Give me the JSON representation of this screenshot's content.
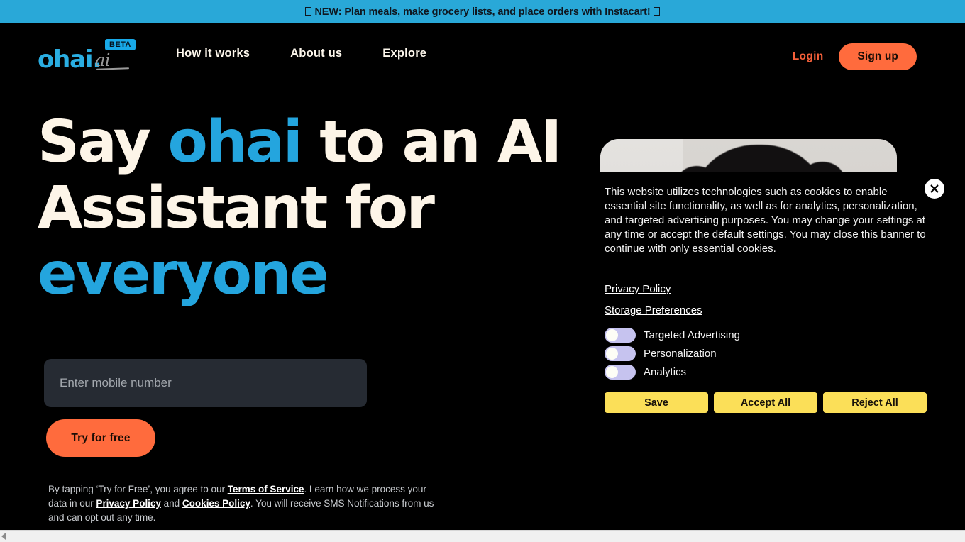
{
  "announcement": {
    "text": "NEW: Plan meals, make grocery lists, and place orders with Instacart!",
    "leading_icon": "missing-glyph-box",
    "trailing_icon": "missing-glyph-box",
    "background": "#29a8d8"
  },
  "header": {
    "logo": {
      "main": "ohai.",
      "suffix": "ai",
      "badge": "BETA",
      "main_color": "#2aaee2",
      "badge_color": "#18a9e8"
    },
    "nav": [
      {
        "label": "How it works"
      },
      {
        "label": "About us"
      },
      {
        "label": "Explore"
      }
    ],
    "login_label": "Login",
    "signup_label": "Sign up",
    "accent_color": "#ff6b3d"
  },
  "hero": {
    "title_part1": "Say ",
    "title_highlight1": "ohai",
    "title_part2": " to an AI Assistant for ",
    "title_highlight2": "everyone",
    "highlight_color": "#24a5de",
    "title_color": "#fdf5e8",
    "phone_placeholder": "Enter mobile number",
    "phone_value": "",
    "cta_label": "Try for free",
    "legal": {
      "seg1": "By tapping ‘Try for Free’, you agree to our ",
      "link1": "Terms of Service",
      "seg2": ". Learn how we process your data in our ",
      "link2": "Privacy Policy",
      "seg3": " and ",
      "link3": "Cookies Policy",
      "seg4": ". You will receive SMS Notifications from us and can opt out any time."
    }
  },
  "cookie_banner": {
    "body": "This website utilizes technologies such as cookies to enable essential site functionality, as well as for analytics, personalization, and targeted advertising purposes. You may change your settings at any time or accept the default settings. You may close this banner to continue with only essential cookies.",
    "links": [
      {
        "label": "Privacy Policy"
      },
      {
        "label": "Storage Preferences"
      }
    ],
    "preferences": [
      {
        "label": "Targeted Advertising",
        "enabled": false
      },
      {
        "label": "Personalization",
        "enabled": false
      },
      {
        "label": "Analytics",
        "enabled": false
      }
    ],
    "buttons": [
      {
        "label": "Save"
      },
      {
        "label": "Accept All"
      },
      {
        "label": "Reject All"
      }
    ],
    "button_color": "#fbdf58",
    "toggle_track_color": "#c6c3ef",
    "close_label": "Close"
  }
}
